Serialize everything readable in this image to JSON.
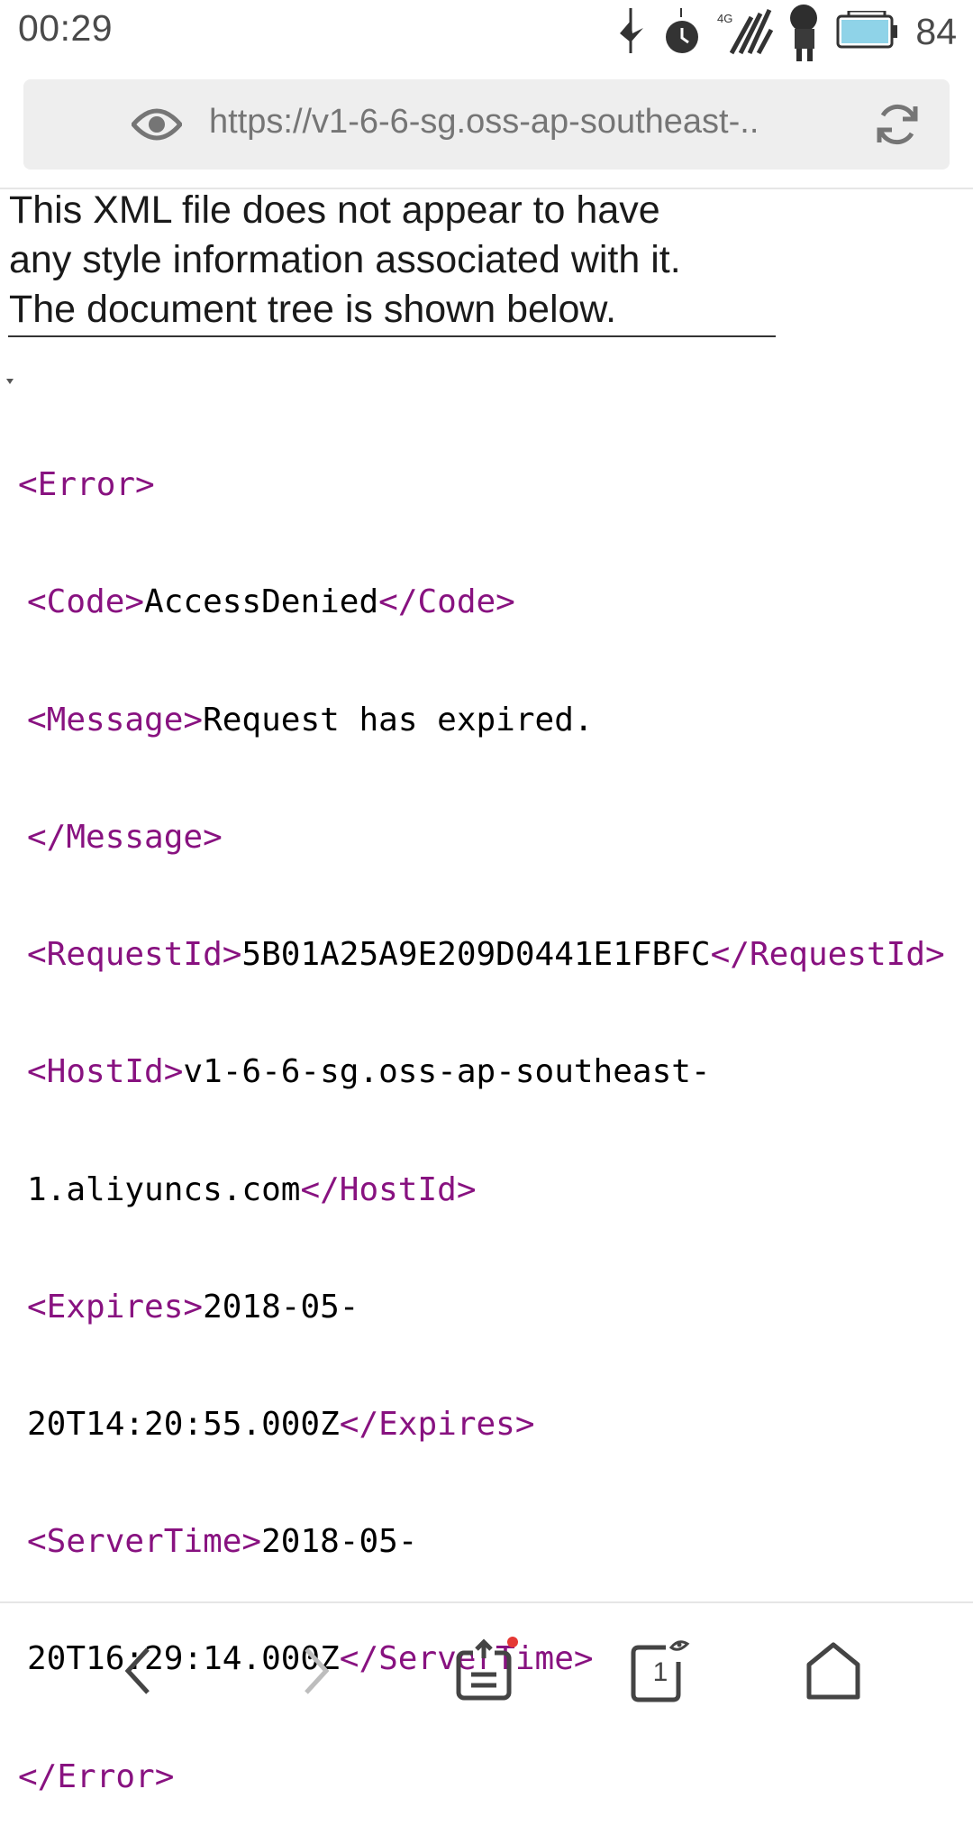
{
  "status_bar": {
    "time": "00:29",
    "network": "4G",
    "battery_percent": "84",
    "icons": [
      "tiktok-icon",
      "alarm-icon",
      "signal-icon",
      "anime-character-icon",
      "battery-icon"
    ]
  },
  "address_bar": {
    "url": "https://v1-6-6-sg.oss-ap-southeast-..",
    "icons": [
      "eye-icon",
      "reload-icon"
    ]
  },
  "notice": {
    "line1": "This XML file does not appear to have",
    "line2": "any style information associated with it.",
    "line3": "The document tree is shown below."
  },
  "xml": {
    "error_open": "<Error>",
    "code_open": "<Code>",
    "code_value": "AccessDenied",
    "code_close": "</Code>",
    "message_open": "<Message>",
    "message_value": "Request has expired.",
    "message_close": "</Message>",
    "requestid_open": "<RequestId>",
    "requestid_value": "5B01A25A9E209D0441E1FBFC",
    "requestid_close": "</RequestId>",
    "hostid_open": "<HostId>",
    "hostid_value_1": "v1-6-6-sg.oss-ap-southeast-",
    "hostid_value_2": "1.aliyuncs.com",
    "hostid_close": "</HostId>",
    "expires_open": "<Expires>",
    "expires_value_1": "2018-05-",
    "expires_value_2": "20T14:20:55.000Z",
    "expires_close": "</Expires>",
    "servertime_open": "<ServerTime>",
    "servertime_value_1": "2018-05-",
    "servertime_value_2": "20T16:29:14.000Z",
    "servertime_close": "</ServerTime>",
    "error_close": "</Error>"
  },
  "bottom_nav": {
    "tab_count": "1",
    "icons": [
      "back-icon",
      "forward-icon",
      "share-icon",
      "tabs-icon",
      "home-icon"
    ],
    "colors": {
      "notification_dot": "#e53935",
      "disabled": "#bdbdbd",
      "enabled": "#444444"
    }
  }
}
